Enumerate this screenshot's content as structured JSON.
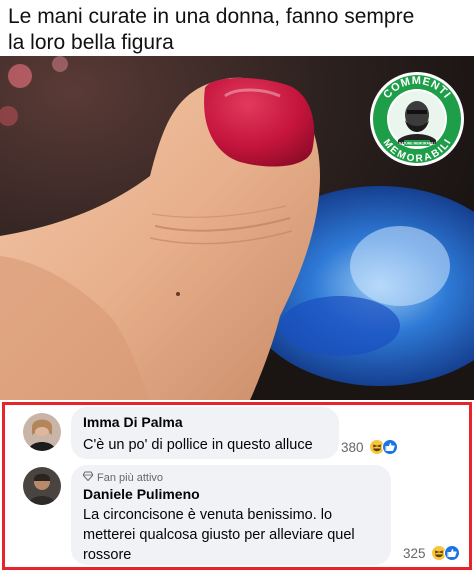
{
  "meme": {
    "caption_line1": "Le mani curate in una donna, fanno sempre",
    "caption_line2": "la loro bella figura"
  },
  "badge": {
    "top_text": "COMMENTI",
    "bottom_text": "MEMORABILI",
    "center_text": "NATURE MEMORABILI",
    "color": "#1f9e4a"
  },
  "comments": [
    {
      "author": "Imma Di Palma",
      "text": "C'è un po' di pollice in questo alluce",
      "reaction_count": "380",
      "reactions": [
        "haha-icon",
        "like-icon"
      ]
    },
    {
      "fan_badge": "Fan più attivo",
      "author": "Daniele Pulimeno",
      "text_line1": "La circoncisone è venuta benissimo. lo",
      "text_line2": "metterei qualcosa giusto per alleviare quel",
      "text_line3": "rossore",
      "reaction_count": "325",
      "reactions": [
        "haha-icon",
        "like-icon"
      ]
    }
  ],
  "colors": {
    "panel_border": "#e8232a",
    "bubble_bg": "#f0f2f5",
    "nail": "#c4143c",
    "like_blue": "#1b74e4",
    "haha_yellow": "#f7c63c"
  }
}
